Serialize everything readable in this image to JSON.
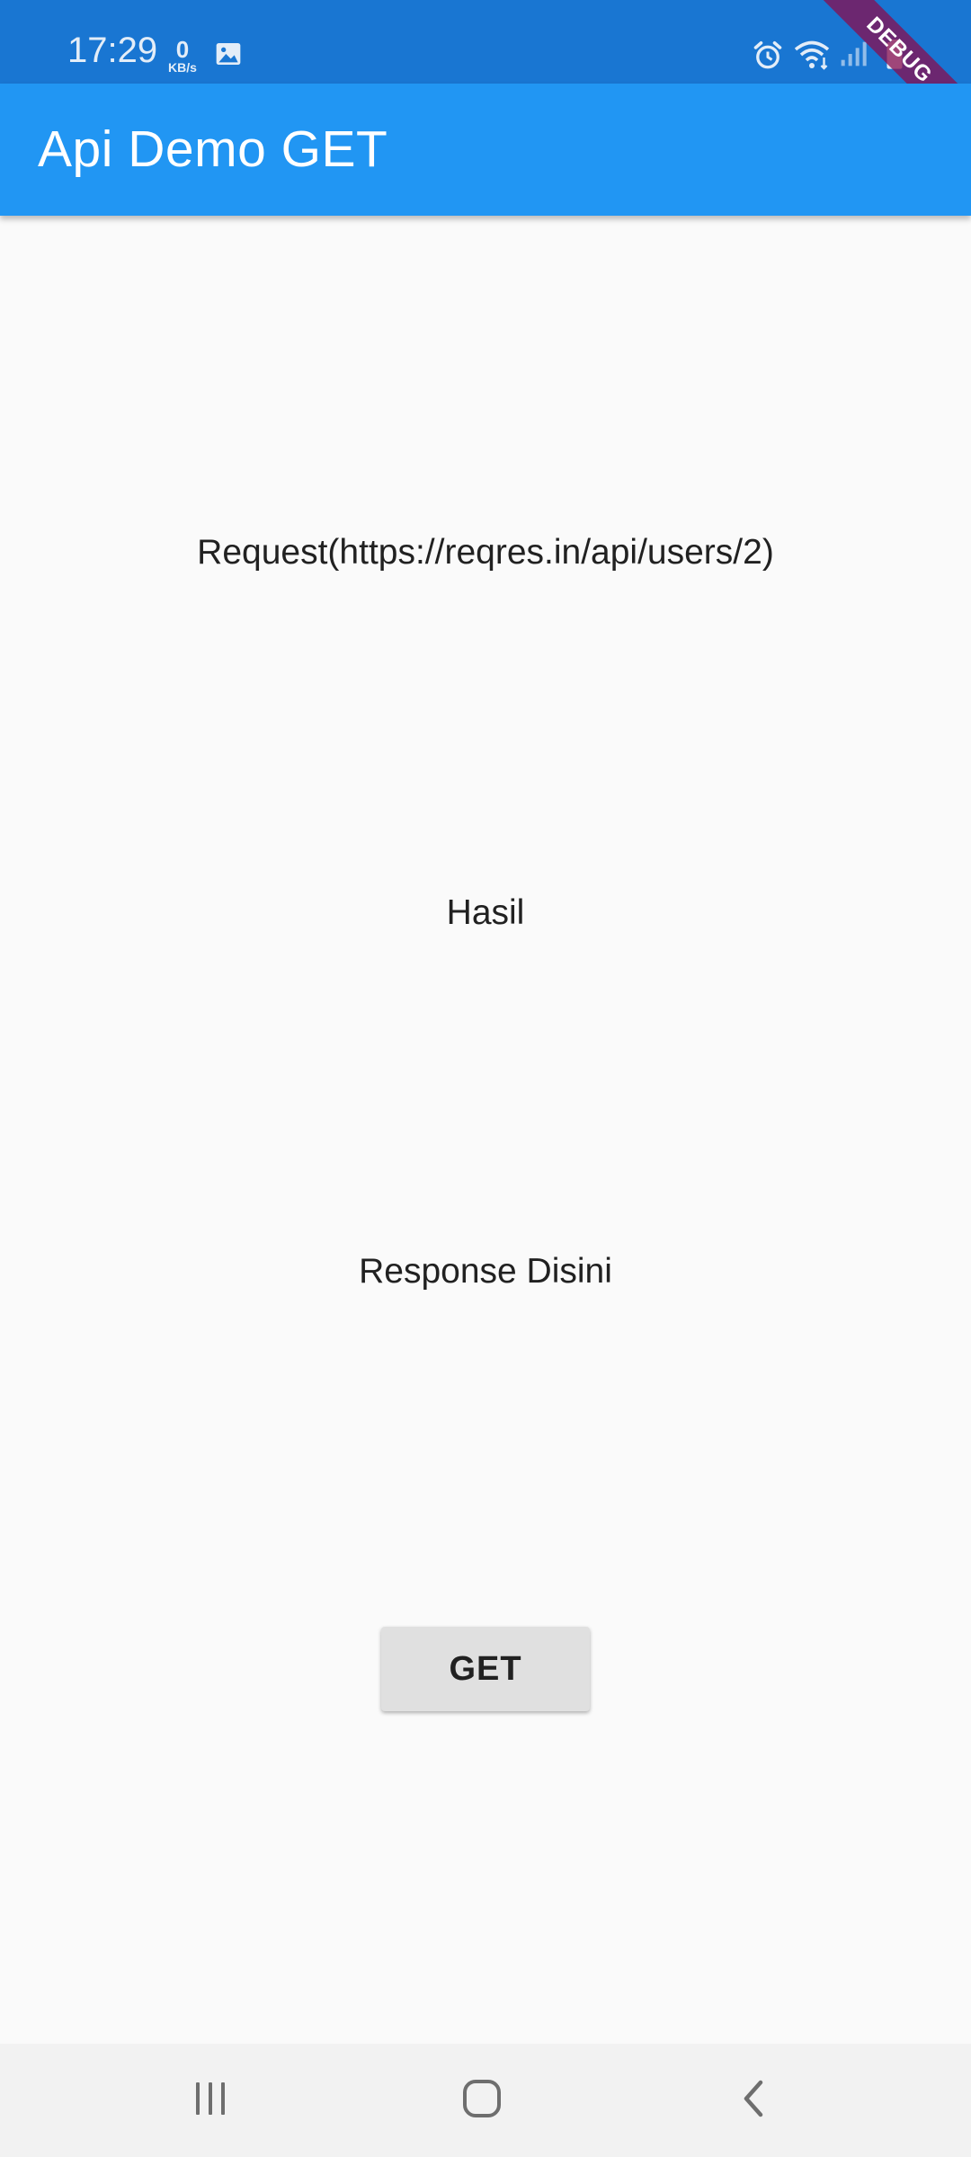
{
  "status_bar": {
    "time": "17:29",
    "net_speed_value": "0",
    "net_speed_unit": "KB/s",
    "icons": [
      "gallery-icon",
      "alarm-icon",
      "wifi-icon",
      "signal-icon",
      "battery-icon"
    ]
  },
  "debug_banner": {
    "label": "DEBUG",
    "color": "#880e4f"
  },
  "app_bar": {
    "title": "Api Demo GET",
    "color": "#2196f3",
    "status_color": "#1976d2"
  },
  "content": {
    "request_label": "Request(https://reqres.in/api/users/2)",
    "result_label": "Hasil",
    "response_label": "Response Disini"
  },
  "actions": {
    "get_label": "GET"
  },
  "nav_bar": {
    "items": [
      "recents-icon",
      "home-icon",
      "back-icon"
    ]
  }
}
